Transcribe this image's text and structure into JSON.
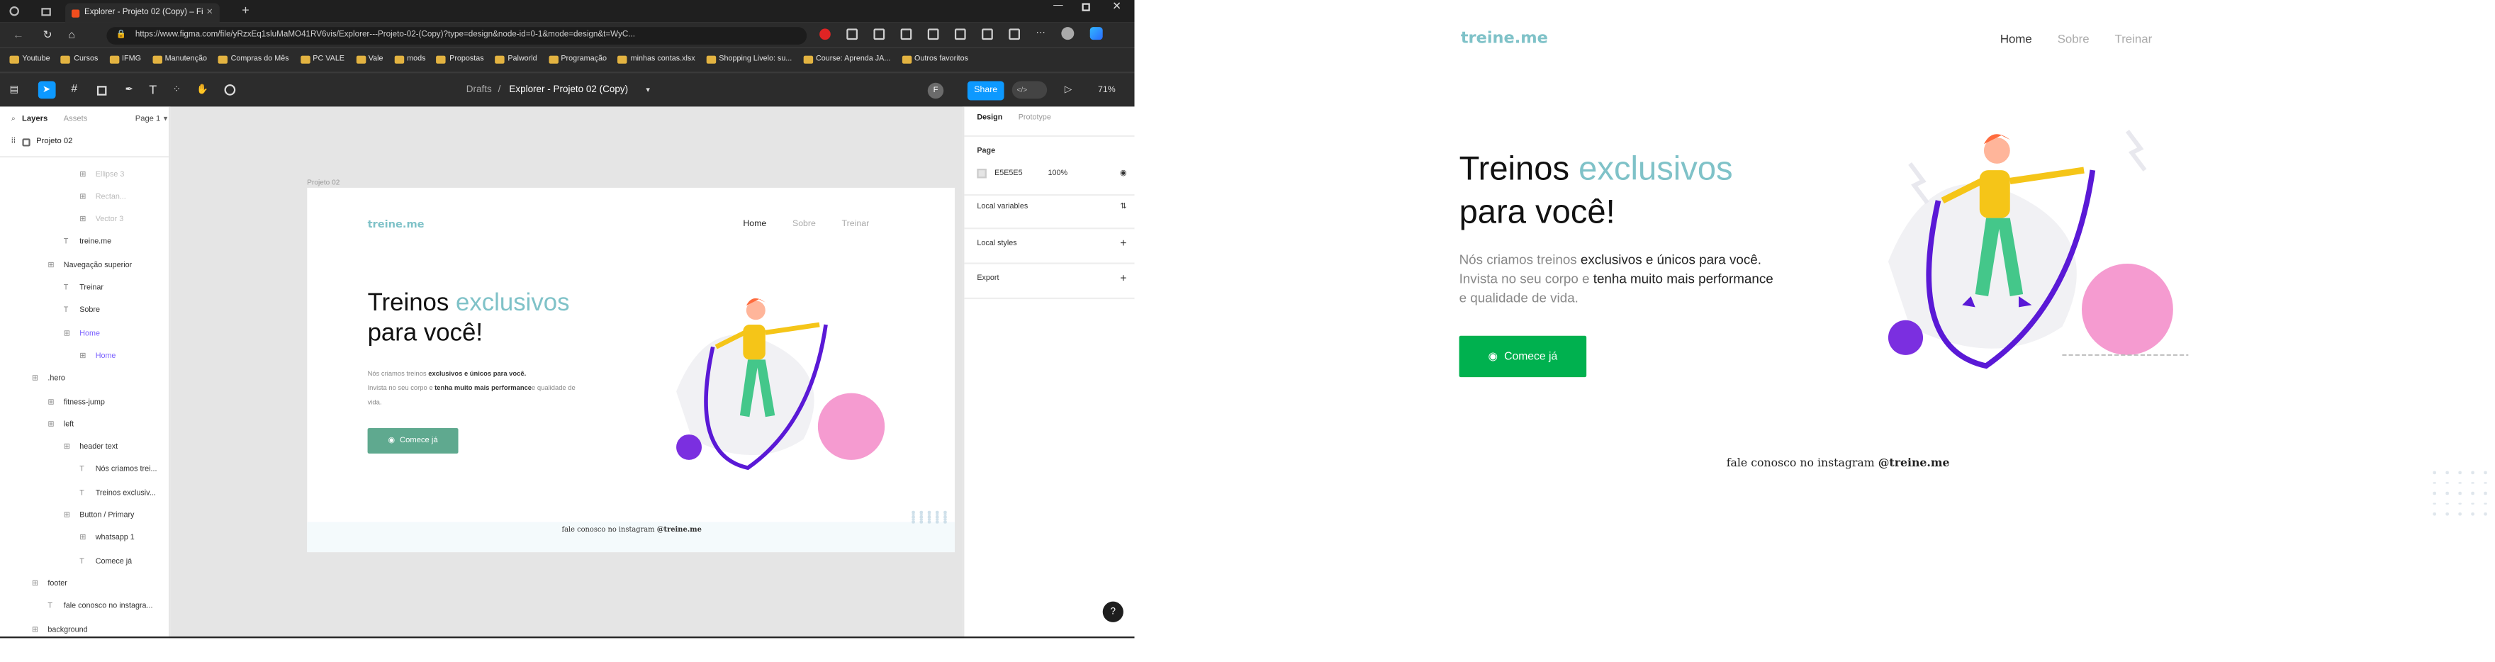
{
  "browser": {
    "tab_title": "Explorer - Projeto 02 (Copy) – Fi",
    "url": "https://www.figma.com/file/yRzxEq1sluMaMO41RV6vis/Explorer---Projeto-02-(Copy)?type=design&node-id=0-1&mode=design&t=WyC...",
    "bookmarks": [
      "Youtube",
      "Cursos",
      "IFMG",
      "Manutenção",
      "Compras do Mês",
      "PC VALE",
      "Vale",
      "mods",
      "Propostas",
      "Palworld",
      "Programação",
      "minhas contas.xlsx",
      "Shopping Livelo: su...",
      "Course: Aprenda JA...",
      "Outros favoritos"
    ]
  },
  "figma": {
    "breadcrumb_drafts": "Drafts",
    "file_title": "Explorer - Projeto 02 (Copy)",
    "share_label": "Share",
    "zoom": "71%",
    "avatar": "F",
    "dev_mode": "</>",
    "tabs": {
      "layers": "Layers",
      "assets": "Assets",
      "page": "Page 1"
    },
    "page_name": "Projeto 02",
    "frame_label": "Projeto 02",
    "layers": [
      {
        "name": "Ellipse 3",
        "indent": 3
      },
      {
        "name": "Rectan...",
        "indent": 3
      },
      {
        "name": "Vector 3",
        "indent": 3
      },
      {
        "name": "treine.me",
        "indent": 2
      },
      {
        "name": "Navegação superior",
        "indent": 1
      },
      {
        "name": "Treinar",
        "indent": 2
      },
      {
        "name": "Sobre",
        "indent": 2
      },
      {
        "name": "Home",
        "indent": 2
      },
      {
        "name": "Home",
        "indent": 3
      },
      {
        "name": ".hero",
        "indent": 0
      },
      {
        "name": "fitness-jump",
        "indent": 1
      },
      {
        "name": "left",
        "indent": 1
      },
      {
        "name": "header text",
        "indent": 2
      },
      {
        "name": "Nós criamos trei...",
        "indent": 3
      },
      {
        "name": "Treinos exclusiv...",
        "indent": 3
      },
      {
        "name": "Button / Primary",
        "indent": 2
      },
      {
        "name": "whatsapp 1",
        "indent": 3
      },
      {
        "name": "Comece já",
        "indent": 3
      },
      {
        "name": "footer",
        "indent": 0
      },
      {
        "name": "fale conosco no instagra...",
        "indent": 1
      },
      {
        "name": "background",
        "indent": 0
      }
    ],
    "right": {
      "tab_design": "Design",
      "tab_prototype": "Prototype",
      "page_section": "Page",
      "page_color": "E5E5E5",
      "page_opacity": "100%",
      "local_variables": "Local variables",
      "local_styles": "Local styles",
      "export": "Export",
      "help": "?"
    }
  },
  "site": {
    "logo": "treine.me",
    "nav": [
      "Home",
      "Sobre",
      "Treinar"
    ],
    "headline_1": "Treinos ",
    "headline_accent": "exclusivos",
    "headline_2": "para você!",
    "sub_a": "Nós criamos treinos ",
    "sub_b": "exclusivos e únicos para você.",
    "sub_c": "Invista no seu corpo e ",
    "sub_d": "tenha muito mais performance",
    "sub_e": "e qualidade de vida.",
    "cta": "Comece já",
    "footer_a": "fale conosco no instagram ",
    "footer_b": "@treine.me"
  },
  "colors": {
    "accent": "#7fc2c8",
    "cta": "#00b14f",
    "share": "#0d99ff",
    "rope": "#5a19d6",
    "ball": "#f59bd0"
  }
}
